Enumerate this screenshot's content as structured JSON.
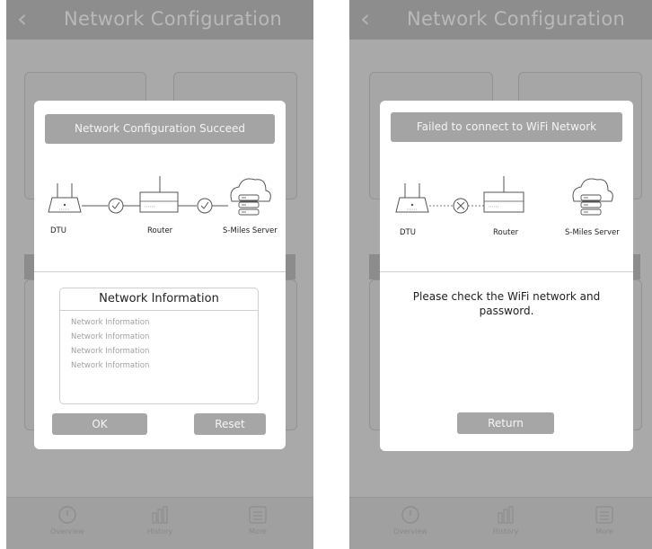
{
  "app": {
    "title": "Network Configuration",
    "back_icon": "back-chevron-icon"
  },
  "tabs": [
    {
      "label": "Overview",
      "icon": "gauge-icon"
    },
    {
      "label": "History",
      "icon": "bar-chart-icon"
    },
    {
      "label": "More",
      "icon": "list-icon"
    }
  ],
  "success_dialog": {
    "header": "Network Configuration Succeed",
    "labels": {
      "dtu": "DTU",
      "router": "Router",
      "server": "S-Miles Server"
    },
    "status": "connected",
    "info_title": "Network Information",
    "info_rows": [
      "Network Information",
      "Network Information",
      "Network Information",
      "Network Information"
    ],
    "ok_button": "OK",
    "reset_button": "Reset"
  },
  "failure_dialog": {
    "header": "Failed to connect to WiFi Network",
    "labels": {
      "dtu": "DTU",
      "router": "Router",
      "server": "S-Miles Server"
    },
    "status": "failed",
    "message_line1": "Please check the WiFi network and",
    "message_line2": "password.",
    "return_button": "Return"
  },
  "colors": {
    "overlay_bg": "#a9a9a9",
    "button_bg": "#a6a6a6",
    "dialog_bg": "#ffffff"
  }
}
